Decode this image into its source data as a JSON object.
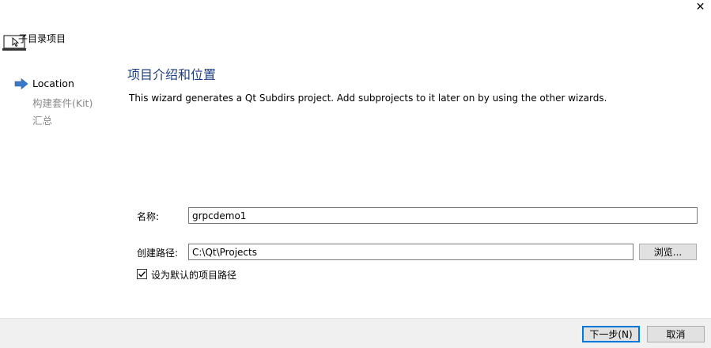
{
  "window": {
    "title": "子目录项目",
    "close_glyph": "✕"
  },
  "nav": {
    "items": [
      {
        "label": "Location",
        "state": "current"
      },
      {
        "label": "构建套件(Kit)",
        "state": "pending"
      },
      {
        "label": "汇总",
        "state": "pending"
      }
    ],
    "current_icon": "arrow-right-icon"
  },
  "main": {
    "heading": "项目介绍和位置",
    "description": "This wizard generates a Qt Subdirs project. Add subprojects to it later on by using the other wizards."
  },
  "form": {
    "name_label": "名称:",
    "name_value": "grpcdemo1",
    "path_label": "创建路径:",
    "path_value": "C:\\Qt\\Projects",
    "browse_label": "浏览...",
    "default_path_label": "设为默认的项目路径",
    "default_path_checked": true
  },
  "footer": {
    "next_label": "下一步(N)",
    "cancel_label": "取消"
  },
  "colors": {
    "accent": "#0078d7",
    "heading": "#1f3e7c",
    "nav_arrow": "#3a78c8"
  }
}
